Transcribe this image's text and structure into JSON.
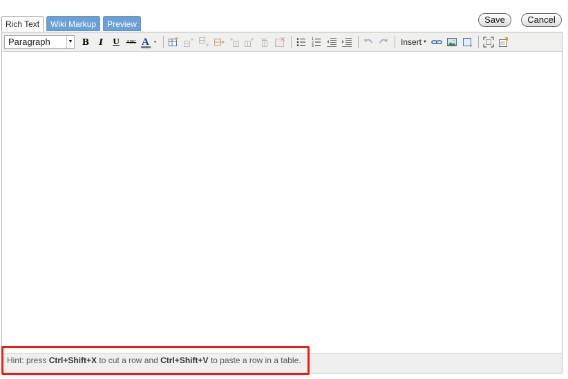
{
  "tabs": [
    {
      "label": "Rich Text",
      "active": true
    },
    {
      "label": "Wiki Markup",
      "active": false
    },
    {
      "label": "Preview",
      "active": false
    }
  ],
  "actions": {
    "save_label": "Save",
    "cancel_label": "Cancel"
  },
  "toolbar": {
    "format_select": {
      "value": "Paragraph"
    },
    "insert_label": "Insert",
    "icons": [
      "bold-icon",
      "italic-icon",
      "underline-icon",
      "strikethrough-icon",
      "text-color-icon",
      "insert-table-icon",
      "table-row-before-icon",
      "table-row-after-icon",
      "table-delete-row-icon",
      "table-col-before-icon",
      "table-col-after-icon",
      "table-delete-col-icon",
      "table-delete-icon",
      "bullet-list-icon",
      "numbered-list-icon",
      "outdent-icon",
      "indent-icon",
      "undo-icon",
      "redo-icon",
      "link-icon",
      "image-icon",
      "macro-icon",
      "fullscreen-icon",
      "properties-icon"
    ]
  },
  "hint": {
    "prefix": "Hint: press",
    "key1": "Ctrl+Shift+X",
    "middle": "to cut a row and",
    "key2": "Ctrl+Shift+V",
    "suffix": "to paste a row in a table."
  },
  "colors": {
    "tab_inactive": "#6c9fd4",
    "highlight": "#ee1c0e",
    "toolbar_bg": "#f0f0ee"
  }
}
